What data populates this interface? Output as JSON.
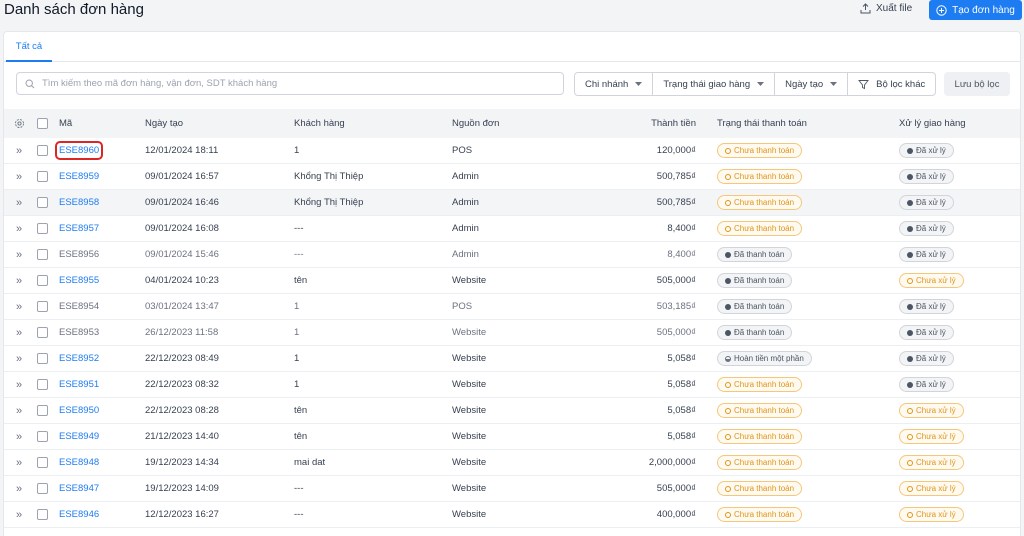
{
  "header": {
    "title": "Danh sách đơn hàng",
    "export_label": "Xuất file",
    "create_label": "Tạo đơn hàng"
  },
  "tabs": [
    {
      "label": "Tất cả"
    }
  ],
  "search": {
    "placeholder": "Tìm kiếm theo mã đơn hàng, vận đơn, SDT khách hàng",
    "value": ""
  },
  "filters": {
    "branch": "Chi nhánh",
    "delivery_status": "Trạng thái giao hàng",
    "created_date": "Ngày tạo",
    "other": "Bộ lọc khác",
    "save": "Lưu bộ lọc"
  },
  "table": {
    "columns": {
      "code": "Mã",
      "created": "Ngày tạo",
      "customer": "Khách hàng",
      "source": "Nguồn đơn",
      "total": "Thành tiền",
      "payment": "Trạng thái thanh toán",
      "shipping": "Xử lý giao hàng"
    },
    "rows": [
      {
        "code": "ESE8960",
        "date": "12/01/2024 18:11",
        "customer": "1",
        "source": "POS",
        "total": "120,000₫",
        "payment": "Chưa thanh toán",
        "shipping": "Đã xử lý"
      },
      {
        "code": "ESE8959",
        "date": "09/01/2024 16:57",
        "customer": "Khổng Thị Thiệp",
        "source": "Admin",
        "total": "500,785₫",
        "payment": "Chưa thanh toán",
        "shipping": "Đã xử lý"
      },
      {
        "code": "ESE8958",
        "date": "09/01/2024 16:46",
        "customer": "Khổng Thị Thiệp",
        "source": "Admin",
        "total": "500,785₫",
        "payment": "Chưa thanh toán",
        "shipping": "Đã xử lý"
      },
      {
        "code": "ESE8957",
        "date": "09/01/2024 16:08",
        "customer": "---",
        "source": "Admin",
        "total": "8,400₫",
        "payment": "Chưa thanh toán",
        "shipping": "Đã xử lý"
      },
      {
        "code": "ESE8956",
        "date": "09/01/2024 15:46",
        "customer": "---",
        "source": "Admin",
        "total": "8,400₫",
        "payment": "Đã thanh toán",
        "shipping": "Đã xử lý"
      },
      {
        "code": "ESE8955",
        "date": "04/01/2024 10:23",
        "customer": "tên",
        "source": "Website",
        "total": "505,000₫",
        "payment": "Đã thanh toán",
        "shipping": "Chưa xử lý"
      },
      {
        "code": "ESE8954",
        "date": "03/01/2024 13:47",
        "customer": "1",
        "source": "POS",
        "total": "503,185₫",
        "payment": "Đã thanh toán",
        "shipping": "Đã xử lý"
      },
      {
        "code": "ESE8953",
        "date": "26/12/2023 11:58",
        "customer": "1",
        "source": "Website",
        "total": "505,000₫",
        "payment": "Đã thanh toán",
        "shipping": "Đã xử lý"
      },
      {
        "code": "ESE8952",
        "date": "22/12/2023 08:49",
        "customer": "1",
        "source": "Website",
        "total": "5,058₫",
        "payment": "Hoàn tiền một phần",
        "shipping": "Đã xử lý"
      },
      {
        "code": "ESE8951",
        "date": "22/12/2023 08:32",
        "customer": "1",
        "source": "Website",
        "total": "5,058₫",
        "payment": "Chưa thanh toán",
        "shipping": "Đã xử lý"
      },
      {
        "code": "ESE8950",
        "date": "22/12/2023 08:28",
        "customer": "tên",
        "source": "Website",
        "total": "5,058₫",
        "payment": "Chưa thanh toán",
        "shipping": "Chưa xử lý"
      },
      {
        "code": "ESE8949",
        "date": "21/12/2023 14:40",
        "customer": "tên",
        "source": "Website",
        "total": "5,058₫",
        "payment": "Chưa thanh toán",
        "shipping": "Chưa xử lý"
      },
      {
        "code": "ESE8948",
        "date": "19/12/2023 14:34",
        "customer": "mai dat",
        "source": "Website",
        "total": "2,000,000₫",
        "payment": "Chưa thanh toán",
        "shipping": "Chưa xử lý"
      },
      {
        "code": "ESE8947",
        "date": "19/12/2023 14:09",
        "customer": "---",
        "source": "Website",
        "total": "505,000₫",
        "payment": "Chưa thanh toán",
        "shipping": "Chưa xử lý"
      },
      {
        "code": "ESE8946",
        "date": "12/12/2023 16:27",
        "customer": "---",
        "source": "Website",
        "total": "400,000₫",
        "payment": "Chưa thanh toán",
        "shipping": "Chưa xử lý"
      }
    ]
  },
  "colors": {
    "accent": "#1d7cf2",
    "warning": "#e09419",
    "neutral": "#4b5563",
    "highlight": "#dc2626"
  }
}
